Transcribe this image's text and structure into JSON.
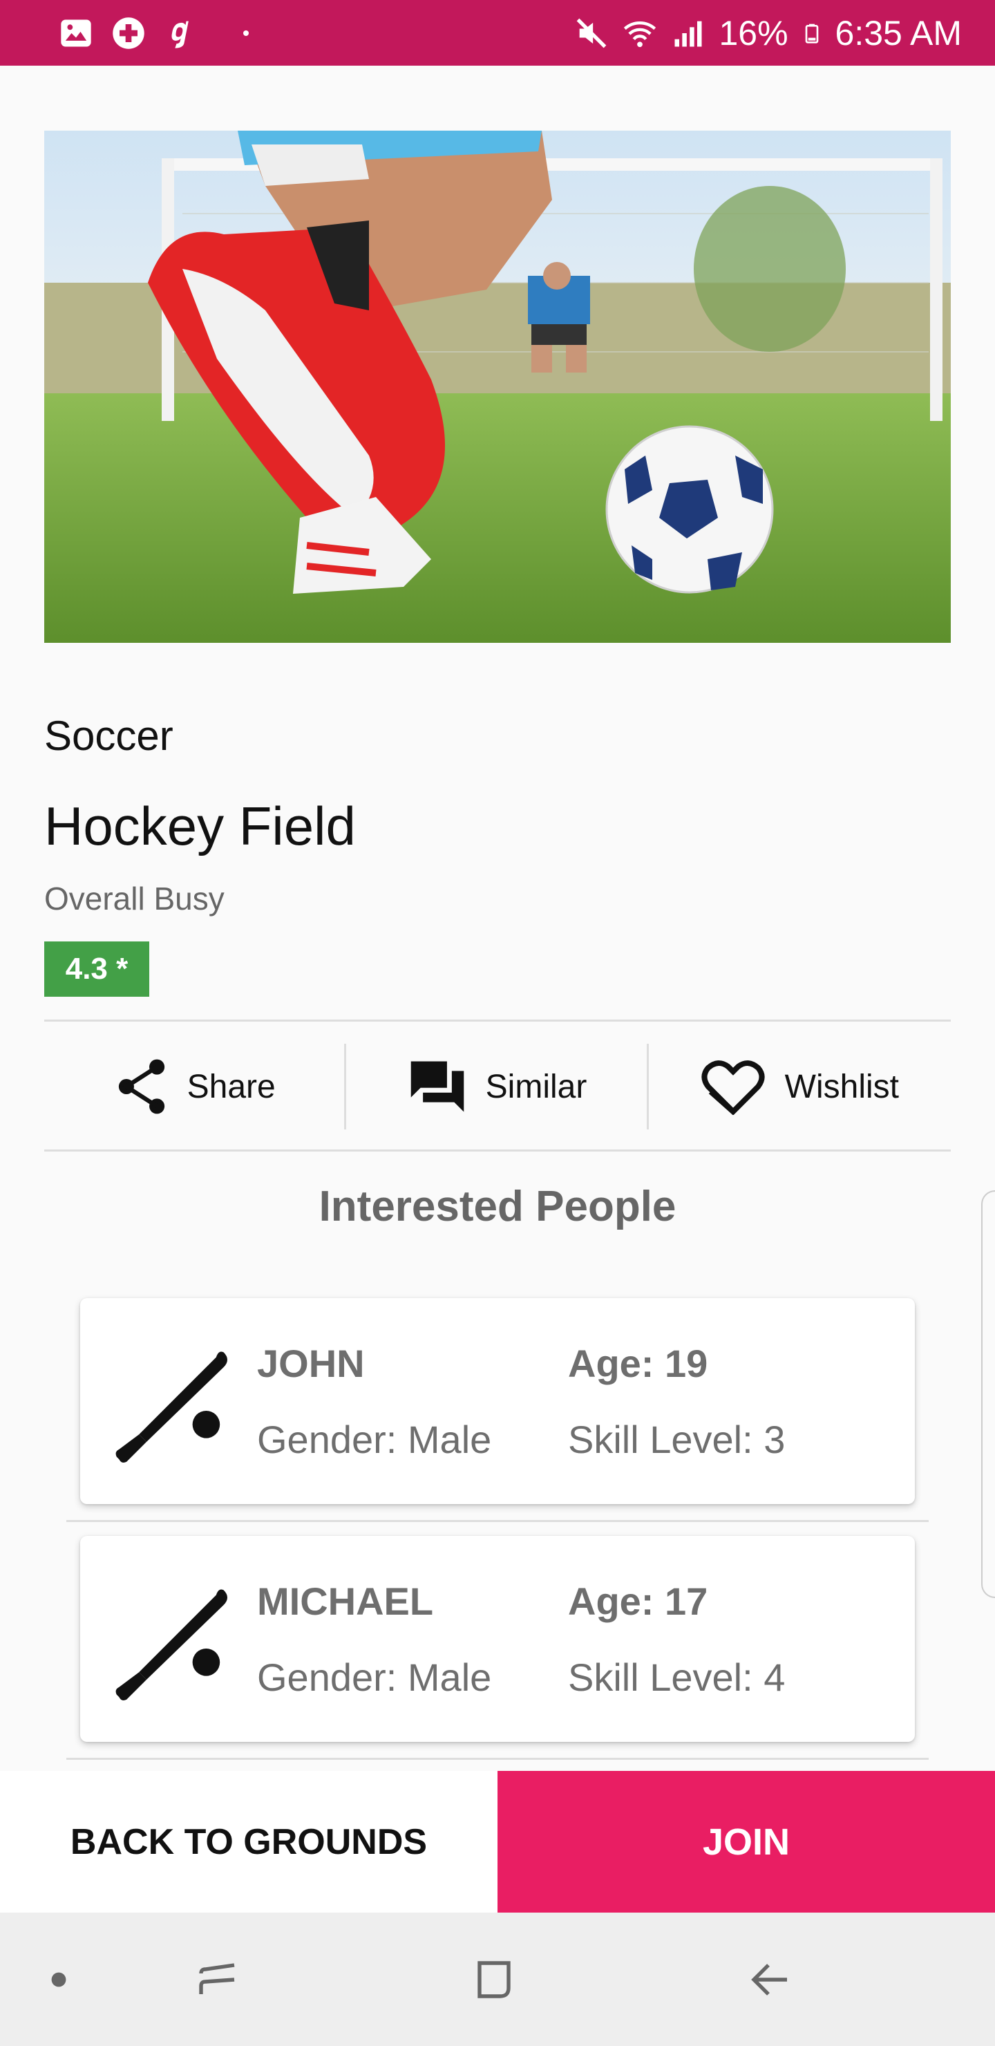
{
  "status_bar": {
    "battery": "16%",
    "time": "6:35 AM",
    "left_icons": [
      "gallery-icon",
      "health-plus-icon",
      "g-app-icon"
    ],
    "right_icons": [
      "mute-icon",
      "wifi-icon",
      "signal-icon",
      "battery-icon"
    ],
    "color": "#c2185b"
  },
  "ground": {
    "sport": "Soccer",
    "name": "Hockey Field",
    "busy_status": "Overall Busy",
    "rating": "4.3 *",
    "rating_color": "#43a047"
  },
  "actions": [
    {
      "label": "Share",
      "icon": "share-icon"
    },
    {
      "label": "Similar",
      "icon": "chat-bubbles-icon"
    },
    {
      "label": "Wishlist",
      "icon": "heart-icon"
    }
  ],
  "interested": {
    "title": "Interested People",
    "people": [
      {
        "name": "JOHN",
        "age": "Age: 19",
        "gender": "Gender: Male",
        "skill": "Skill Level: 3",
        "icon": "baseball-bat-icon"
      },
      {
        "name": "MICHAEL",
        "age": "Age: 17",
        "gender": "Gender: Male",
        "skill": "Skill Level: 4",
        "icon": "baseball-bat-icon"
      }
    ]
  },
  "buttons": {
    "back": "BACK TO GROUNDS",
    "join": "JOIN",
    "accent": "#e91e63"
  },
  "nav_bar": {
    "icons": [
      "dot-icon",
      "recents-icon",
      "home-icon",
      "back-icon"
    ]
  }
}
